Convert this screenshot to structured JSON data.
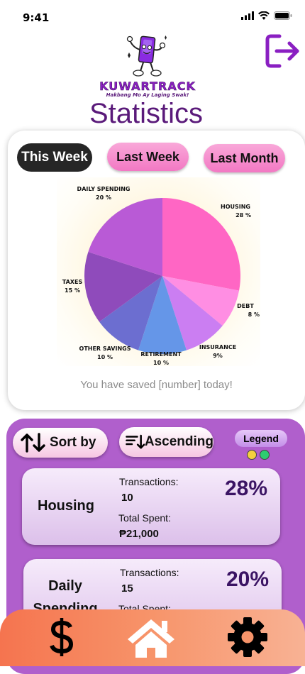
{
  "status": {
    "time": "9:41"
  },
  "brand": {
    "name": "KUWARTRACK",
    "tagline": "Hakbang Mo Ay Laging Swak!"
  },
  "page": {
    "title": "Statistics"
  },
  "tabs": [
    {
      "label": "This Week",
      "active": true
    },
    {
      "label": "Last Week",
      "active": false
    },
    {
      "label": "Last Month",
      "active": false
    }
  ],
  "chart_data": {
    "type": "pie",
    "slices": [
      {
        "label": "HOUSING",
        "value_label": "28 %",
        "value": 28,
        "color": "#ff66c4"
      },
      {
        "label": "DEBT",
        "value_label": "8 %",
        "value": 8,
        "color": "#ff8ee3"
      },
      {
        "label": "INSURANCE",
        "value_label": "9%",
        "value": 9,
        "color": "#cb7ef2"
      },
      {
        "label": "RETIREMENT",
        "value_label": "10 %",
        "value": 10,
        "color": "#6596e8"
      },
      {
        "label": "OTHER SAVINGS",
        "value_label": "10 %",
        "value": 10,
        "color": "#6c6ed0"
      },
      {
        "label": "TAXES",
        "value_label": "15 %",
        "value": 15,
        "color": "#8f4bbb"
      },
      {
        "label": "DAILY SPENDING",
        "value_label": "20 %",
        "value": 20,
        "color": "#b95ad6"
      }
    ]
  },
  "saved_message": "You have saved [number] today!",
  "controls": {
    "sort_label": "Sort by",
    "order_label": "Ascending",
    "legend_label": "Legend",
    "legend_colors": [
      "#f4d03f",
      "#2ecc71"
    ]
  },
  "categories": [
    {
      "name": "Housing",
      "transactions_label": "Transactions:",
      "transactions": "10",
      "total_label": "Total Spent:",
      "total": "₱21,000",
      "percent": "28%"
    },
    {
      "name": "Daily Spending",
      "transactions_label": "Transactions:",
      "transactions": "15",
      "total_label": "Total Spent:",
      "total": "",
      "percent": "20%"
    }
  ],
  "nav": {
    "icons": [
      "dollar-icon",
      "home-icon",
      "gear-icon"
    ]
  }
}
